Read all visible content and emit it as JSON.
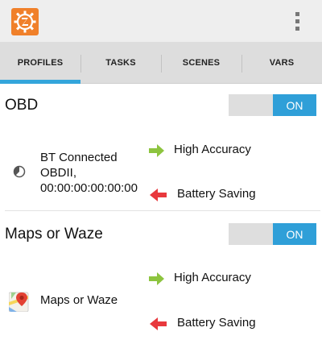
{
  "app": {
    "icon": "tasker-gear-icon",
    "accent_color": "#f0802a"
  },
  "tabs": [
    {
      "label": "PROFILES",
      "selected": true
    },
    {
      "label": "TASKS",
      "selected": false
    },
    {
      "label": "SCENES",
      "selected": false
    },
    {
      "label": "VARS",
      "selected": false
    }
  ],
  "tab_indicator_color": "#33a5db",
  "profiles": [
    {
      "name": "OBD",
      "toggle_label": "ON",
      "context": {
        "icon": "bluetooth-state-icon",
        "lines": [
          "BT Connected",
          "OBDII,",
          "00:00:00:00:00:00"
        ]
      },
      "enter_task": {
        "icon": "green-arrow-right-icon",
        "label": "High Accuracy"
      },
      "exit_task": {
        "icon": "red-arrow-left-icon",
        "label": "Battery Saving"
      }
    },
    {
      "name": "Maps or Waze",
      "toggle_label": "ON",
      "context": {
        "icon": "google-maps-icon",
        "lines": [
          "Maps or Waze"
        ]
      },
      "enter_task": {
        "icon": "green-arrow-right-icon",
        "label": "High Accuracy"
      },
      "exit_task": {
        "icon": "red-arrow-left-icon",
        "label": "Battery Saving"
      }
    }
  ],
  "colors": {
    "toggle_on": "#2f9fd8",
    "enter_arrow": "#8dc43f",
    "exit_arrow": "#e8383d"
  }
}
